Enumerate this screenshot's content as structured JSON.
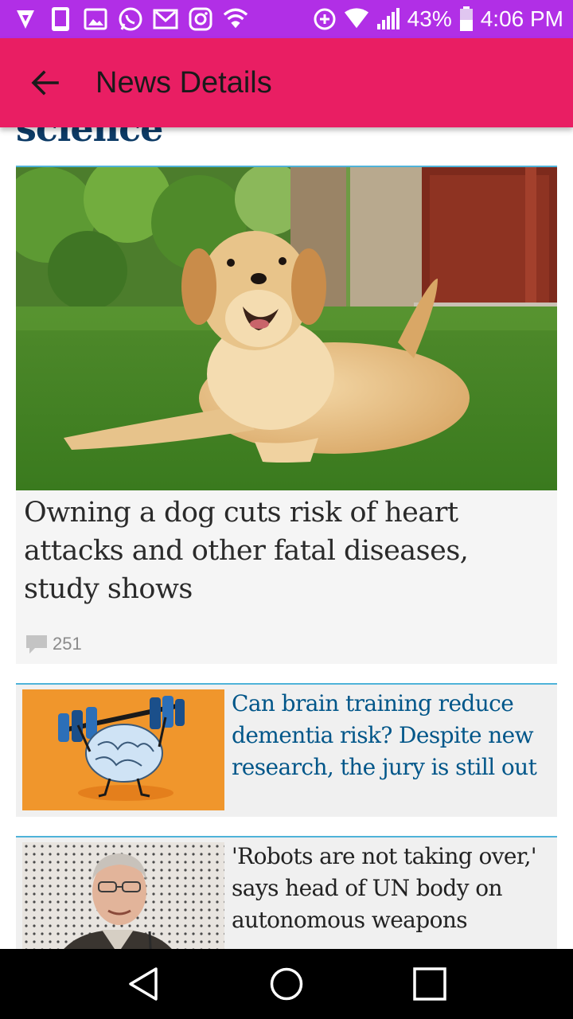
{
  "status_bar": {
    "battery_percent": "43%",
    "time": "4:06 PM",
    "left_icons": [
      "shield-icon",
      "phone-icon",
      "gallery-icon",
      "whatsapp-icon",
      "gmail-icon",
      "instagram-icon",
      "wifi-icon"
    ],
    "right_icons": [
      "data-saver-icon",
      "wifi-signal-icon",
      "cell-signal-icon",
      "battery-icon"
    ]
  },
  "app_bar": {
    "title": "News Details",
    "back_icon": "arrow-back-icon"
  },
  "content": {
    "section_label": "science",
    "featured": {
      "headline": "Owning a dog cuts risk of heart attacks and other fatal diseases, study shows",
      "comment_count": "251",
      "image": "dog-on-grass-photo"
    },
    "items": [
      {
        "headline": "Can brain training reduce dementia risk? Despite new research, the jury is still out",
        "image": "brain-lifting-weights-illustration"
      },
      {
        "headline": "'Robots are not taking over,' says head of UN body on autonomous weapons",
        "image": "man-portrait-photo"
      }
    ]
  },
  "nav_bar": {
    "icons": [
      "back-triangle-icon",
      "home-circle-icon",
      "recents-square-icon"
    ]
  },
  "colors": {
    "status_bar": "#b12fe6",
    "app_bar": "#e91e63",
    "accent_line": "#4fb3d9",
    "headline_blue": "#005689",
    "section_navy": "#0d3b66"
  }
}
